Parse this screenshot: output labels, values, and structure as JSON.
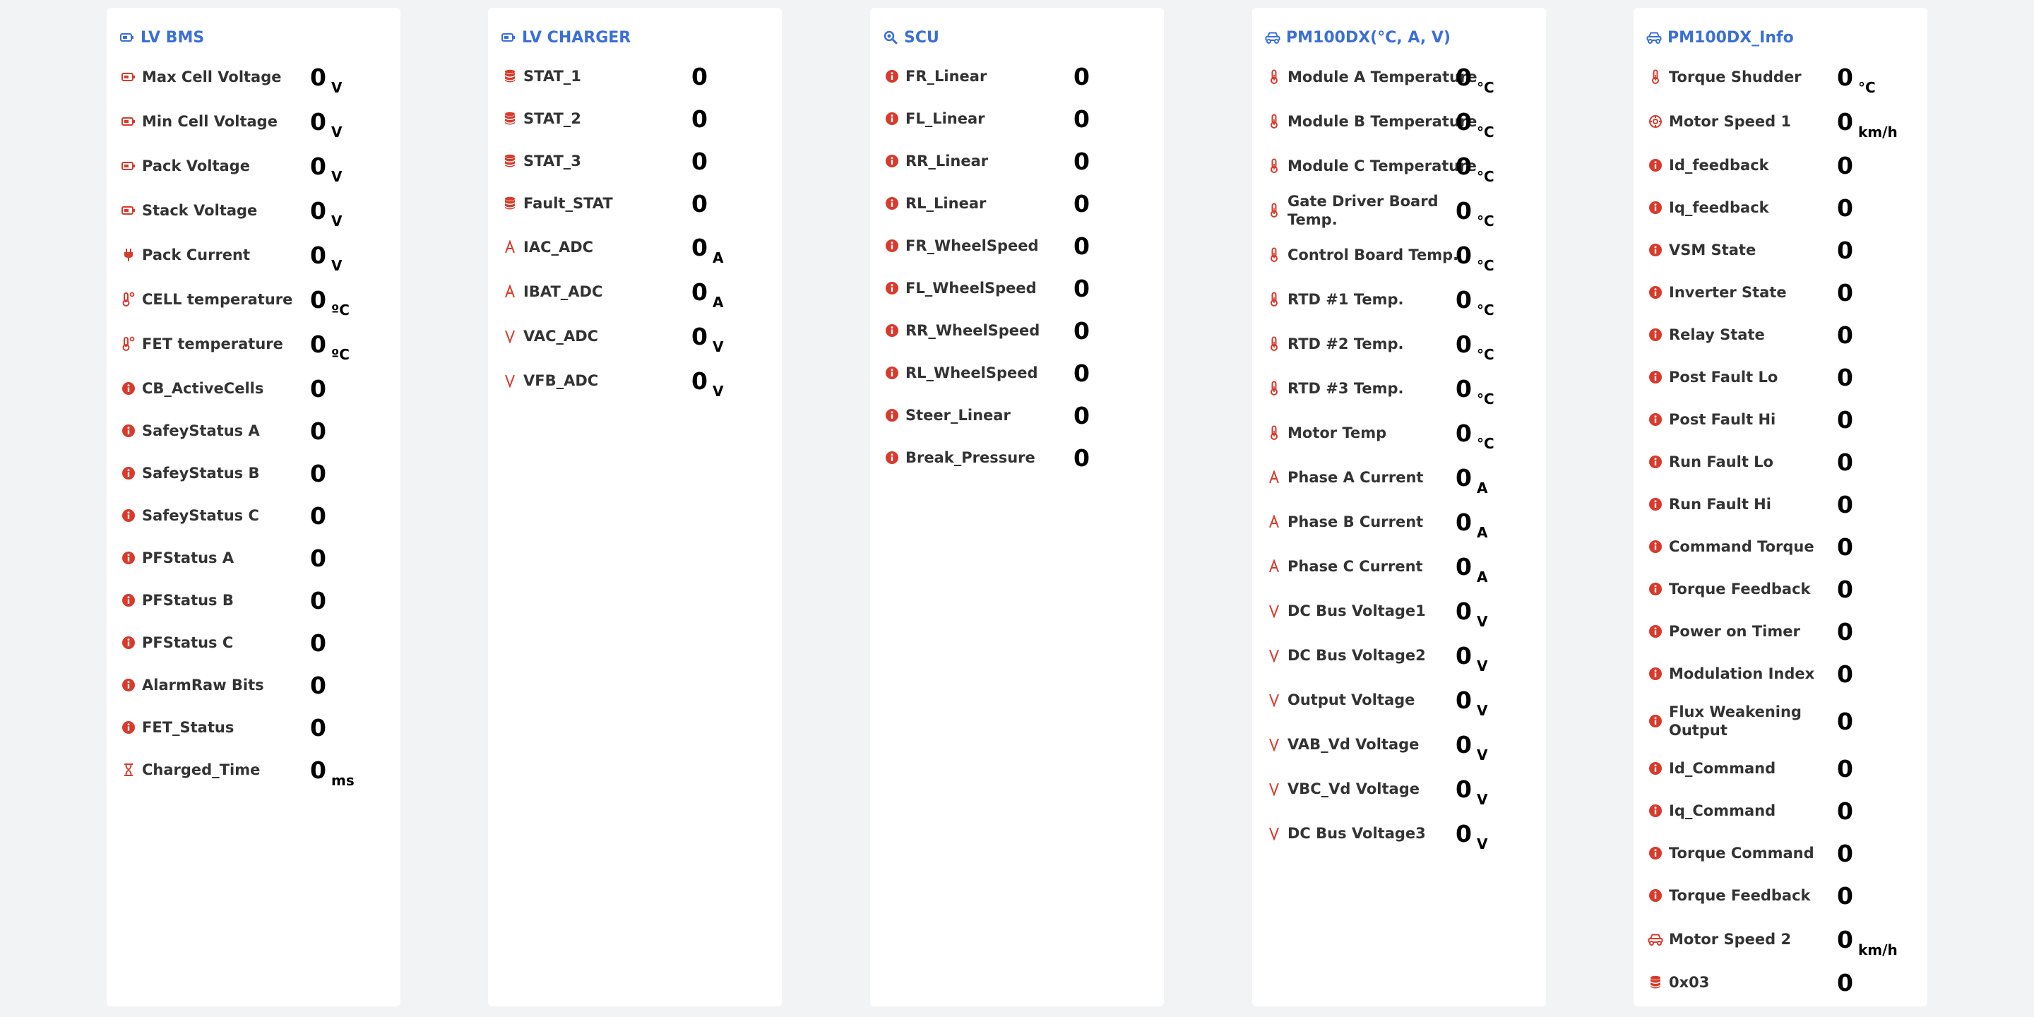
{
  "colors": {
    "title": "#3a6fd8",
    "icon_red": "#d93a2b",
    "value": "#000000",
    "label": "#333333",
    "panel_bg": "#ffffff",
    "page_bg": "#f2f3f5"
  },
  "panels": [
    {
      "title": "LV BMS",
      "title_icon": "battery-icon",
      "rows": [
        {
          "icon": "battery-icon",
          "label": "Max Cell Voltage",
          "value": "0",
          "unit": "V"
        },
        {
          "icon": "battery-icon",
          "label": "Min Cell Voltage",
          "value": "0",
          "unit": "V"
        },
        {
          "icon": "battery-icon",
          "label": "Pack Voltage",
          "value": "0",
          "unit": "V"
        },
        {
          "icon": "battery-icon",
          "label": "Stack Voltage",
          "value": "0",
          "unit": "V"
        },
        {
          "icon": "plug-icon",
          "label": "Pack Current",
          "value": "0",
          "unit": "V"
        },
        {
          "icon": "thermometer-degree-icon",
          "label": "CELL temperature",
          "value": "0",
          "unit": "ºC"
        },
        {
          "icon": "thermometer-degree-icon",
          "label": "FET temperature",
          "value": "0",
          "unit": "ºC"
        },
        {
          "icon": "info-icon",
          "label": "CB_ActiveCells",
          "value": "0",
          "unit": ""
        },
        {
          "icon": "info-icon",
          "label": "SafeyStatus A",
          "value": "0",
          "unit": ""
        },
        {
          "icon": "info-icon",
          "label": "SafeyStatus B",
          "value": "0",
          "unit": ""
        },
        {
          "icon": "info-icon",
          "label": "SafeyStatus C",
          "value": "0",
          "unit": ""
        },
        {
          "icon": "info-icon",
          "label": "PFStatus A",
          "value": "0",
          "unit": ""
        },
        {
          "icon": "info-icon",
          "label": "PFStatus B",
          "value": "0",
          "unit": ""
        },
        {
          "icon": "info-icon",
          "label": "PFStatus C",
          "value": "0",
          "unit": ""
        },
        {
          "icon": "info-icon",
          "label": "AlarmRaw Bits",
          "value": "0",
          "unit": ""
        },
        {
          "icon": "info-icon",
          "label": "FET_Status",
          "value": "0",
          "unit": ""
        },
        {
          "icon": "hourglass-icon",
          "label": "Charged_Time",
          "value": "0",
          "unit": "ms"
        }
      ]
    },
    {
      "title": "LV CHARGER",
      "title_icon": "battery-icon",
      "rows": [
        {
          "icon": "database-icon",
          "label": "STAT_1",
          "value": "0",
          "unit": ""
        },
        {
          "icon": "database-icon",
          "label": "STAT_2",
          "value": "0",
          "unit": ""
        },
        {
          "icon": "database-icon",
          "label": "STAT_3",
          "value": "0",
          "unit": ""
        },
        {
          "icon": "database-icon",
          "label": "Fault_STAT",
          "value": "0",
          "unit": ""
        },
        {
          "icon": "ampere-icon",
          "label": "IAC_ADC",
          "value": "0",
          "unit": "A"
        },
        {
          "icon": "ampere-icon",
          "label": "IBAT_ADC",
          "value": "0",
          "unit": "A"
        },
        {
          "icon": "volt-icon",
          "label": "VAC_ADC",
          "value": "0",
          "unit": "V"
        },
        {
          "icon": "volt-icon",
          "label": "VFB_ADC",
          "value": "0",
          "unit": "V"
        }
      ]
    },
    {
      "title": "SCU",
      "title_icon": "search-icon",
      "rows": [
        {
          "icon": "info-icon",
          "label": "FR_Linear",
          "value": "0",
          "unit": ""
        },
        {
          "icon": "info-icon",
          "label": "FL_Linear",
          "value": "0",
          "unit": ""
        },
        {
          "icon": "info-icon",
          "label": "RR_Linear",
          "value": "0",
          "unit": ""
        },
        {
          "icon": "info-icon",
          "label": "RL_Linear",
          "value": "0",
          "unit": ""
        },
        {
          "icon": "info-icon",
          "label": "FR_WheelSpeed",
          "value": "0",
          "unit": ""
        },
        {
          "icon": "info-icon",
          "label": "FL_WheelSpeed",
          "value": "0",
          "unit": ""
        },
        {
          "icon": "info-icon",
          "label": "RR_WheelSpeed",
          "value": "0",
          "unit": ""
        },
        {
          "icon": "info-icon",
          "label": "RL_WheelSpeed",
          "value": "0",
          "unit": ""
        },
        {
          "icon": "info-icon",
          "label": "Steer_Linear",
          "value": "0",
          "unit": ""
        },
        {
          "icon": "info-icon",
          "label": "Break_Pressure",
          "value": "0",
          "unit": ""
        }
      ]
    },
    {
      "title": "PM100DX(°C, A, V)",
      "title_icon": "car-icon",
      "rows": [
        {
          "icon": "thermometer-icon",
          "label": "Module A Temperature",
          "value": "0",
          "unit": "°C"
        },
        {
          "icon": "thermometer-icon",
          "label": "Module B Temperature",
          "value": "0",
          "unit": "°C"
        },
        {
          "icon": "thermometer-icon",
          "label": "Module C Temperature",
          "value": "0",
          "unit": "°C"
        },
        {
          "icon": "thermometer-icon",
          "label": "Gate Driver Board Temp.",
          "value": "0",
          "unit": "°C"
        },
        {
          "icon": "thermometer-icon",
          "label": "Control Board Temp.",
          "value": "0",
          "unit": "°C"
        },
        {
          "icon": "thermometer-icon",
          "label": "RTD #1 Temp.",
          "value": "0",
          "unit": "°C"
        },
        {
          "icon": "thermometer-icon",
          "label": "RTD #2 Temp.",
          "value": "0",
          "unit": "°C"
        },
        {
          "icon": "thermometer-icon",
          "label": "RTD #3 Temp.",
          "value": "0",
          "unit": "°C"
        },
        {
          "icon": "thermometer-icon",
          "label": "Motor Temp",
          "value": "0",
          "unit": "°C"
        },
        {
          "icon": "ampere-icon",
          "label": "Phase A Current",
          "value": "0",
          "unit": "A"
        },
        {
          "icon": "ampere-icon",
          "label": "Phase B Current",
          "value": "0",
          "unit": "A"
        },
        {
          "icon": "ampere-icon",
          "label": "Phase C Current",
          "value": "0",
          "unit": "A"
        },
        {
          "icon": "volt-icon",
          "label": "DC Bus Voltage1",
          "value": "0",
          "unit": "V"
        },
        {
          "icon": "volt-icon",
          "label": "DC Bus Voltage2",
          "value": "0",
          "unit": "V"
        },
        {
          "icon": "volt-icon",
          "label": "Output Voltage",
          "value": "0",
          "unit": "V"
        },
        {
          "icon": "volt-icon",
          "label": "VAB_Vd Voltage",
          "value": "0",
          "unit": "V"
        },
        {
          "icon": "volt-icon",
          "label": "VBC_Vd Voltage",
          "value": "0",
          "unit": "V"
        },
        {
          "icon": "volt-icon",
          "label": "DC Bus Voltage3",
          "value": "0",
          "unit": "V"
        }
      ]
    },
    {
      "title": "PM100DX_Info",
      "title_icon": "car-icon",
      "rows": [
        {
          "icon": "thermometer-icon",
          "label": "Torque Shudder",
          "value": "0",
          "unit": "°C"
        },
        {
          "icon": "gauge-icon",
          "label": "Motor Speed 1",
          "value": "0",
          "unit": "km/h"
        },
        {
          "icon": "info-icon",
          "label": "Id_feedback",
          "value": "0",
          "unit": ""
        },
        {
          "icon": "info-icon",
          "label": "Iq_feedback",
          "value": "0",
          "unit": ""
        },
        {
          "icon": "info-icon",
          "label": "VSM State",
          "value": "0",
          "unit": ""
        },
        {
          "icon": "info-icon",
          "label": "Inverter State",
          "value": "0",
          "unit": ""
        },
        {
          "icon": "info-icon",
          "label": "Relay State",
          "value": "0",
          "unit": ""
        },
        {
          "icon": "info-icon",
          "label": "Post Fault Lo",
          "value": "0",
          "unit": ""
        },
        {
          "icon": "info-icon",
          "label": "Post Fault Hi",
          "value": "0",
          "unit": ""
        },
        {
          "icon": "info-icon",
          "label": "Run Fault Lo",
          "value": "0",
          "unit": ""
        },
        {
          "icon": "info-icon",
          "label": "Run Fault Hi",
          "value": "0",
          "unit": ""
        },
        {
          "icon": "info-icon",
          "label": "Command Torque",
          "value": "0",
          "unit": ""
        },
        {
          "icon": "info-icon",
          "label": "Torque Feedback",
          "value": "0",
          "unit": ""
        },
        {
          "icon": "info-icon",
          "label": "Power on Timer",
          "value": "0",
          "unit": ""
        },
        {
          "icon": "info-icon",
          "label": "Modulation Index",
          "value": "0",
          "unit": ""
        },
        {
          "icon": "info-icon",
          "label": "Flux Weakening Output",
          "value": "0",
          "unit": ""
        },
        {
          "icon": "info-icon",
          "label": "Id_Command",
          "value": "0",
          "unit": ""
        },
        {
          "icon": "info-icon",
          "label": "Iq_Command",
          "value": "0",
          "unit": ""
        },
        {
          "icon": "info-icon",
          "label": "Torque Command",
          "value": "0",
          "unit": ""
        },
        {
          "icon": "info-icon",
          "label": "Torque Feedback",
          "value": "0",
          "unit": ""
        },
        {
          "icon": "car-icon",
          "label": "Motor Speed 2",
          "value": "0",
          "unit": "km/h"
        },
        {
          "icon": "database-icon",
          "label": "0x03",
          "value": "0",
          "unit": ""
        }
      ]
    }
  ]
}
